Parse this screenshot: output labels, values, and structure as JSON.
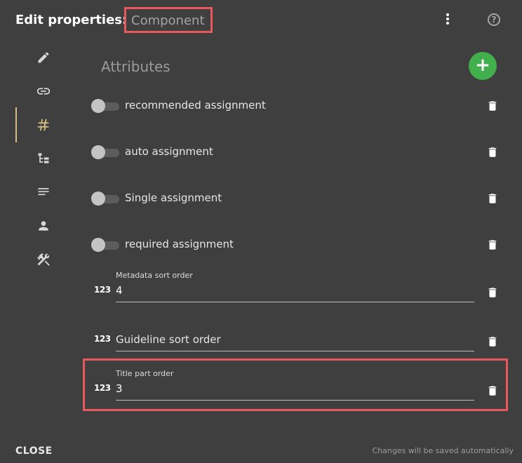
{
  "header": {
    "title": "Edit properties:",
    "subject": "Component",
    "more_icon": "more-vertical-icon",
    "help_icon": "help-circle-icon"
  },
  "sidebar": {
    "items": [
      {
        "icon": "pencil-icon",
        "active": false
      },
      {
        "icon": "link-icon",
        "active": false
      },
      {
        "icon": "hash-icon",
        "active": true
      },
      {
        "icon": "tree-icon",
        "active": false
      },
      {
        "icon": "text-lines-icon",
        "active": false
      },
      {
        "icon": "person-icon",
        "active": false
      },
      {
        "icon": "tools-icon",
        "active": false
      }
    ]
  },
  "section": {
    "title": "Attributes",
    "add_label": "+"
  },
  "toggles": [
    {
      "label": "recommended assignment",
      "on": false
    },
    {
      "label": "auto assignment",
      "on": false
    },
    {
      "label": "Single assignment",
      "on": false
    },
    {
      "label": "required assignment",
      "on": false
    }
  ],
  "numeric_fields": [
    {
      "icon_text": "123",
      "label": "Metadata sort order",
      "value": "4"
    },
    {
      "icon_text": "123",
      "label": "",
      "placeholder": "Guideline sort order",
      "value": ""
    },
    {
      "icon_text": "123",
      "label": "Title part order",
      "value": "3"
    }
  ],
  "footer": {
    "close_label": "CLOSE",
    "autosave_text": "Changes will be saved automatically"
  },
  "colors": {
    "background": "#3f3f3f",
    "accent_active": "#d8bd87",
    "add_button": "#40af4c",
    "highlight": "#e8575c"
  }
}
